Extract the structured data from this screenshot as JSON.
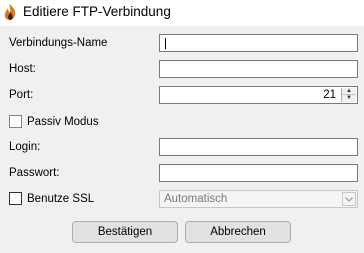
{
  "window": {
    "title": "Editiere FTP-Verbindung"
  },
  "form": {
    "connection_name": {
      "label": "Verbindungs-Name",
      "value": ""
    },
    "host": {
      "label": "Host:",
      "value": ""
    },
    "port": {
      "label": "Port:",
      "value": "21"
    },
    "passive_mode": {
      "label": "Passiv Modus",
      "checked": false
    },
    "login": {
      "label": "Login:",
      "value": ""
    },
    "password": {
      "label": "Passwort:",
      "value": ""
    },
    "use_ssl": {
      "label": "Benutze SSL",
      "checked": false,
      "mode_selected": "Automatisch"
    }
  },
  "buttons": {
    "confirm": "Bestätigen",
    "cancel": "Abbrechen"
  },
  "icons": {
    "app": "flame-icon",
    "spin_up": "chevron-up-icon",
    "spin_down": "chevron-down-icon",
    "dropdown": "chevron-down-icon"
  },
  "colors": {
    "accent": "#d9781e",
    "checkbox_border": "#c07a1e"
  }
}
